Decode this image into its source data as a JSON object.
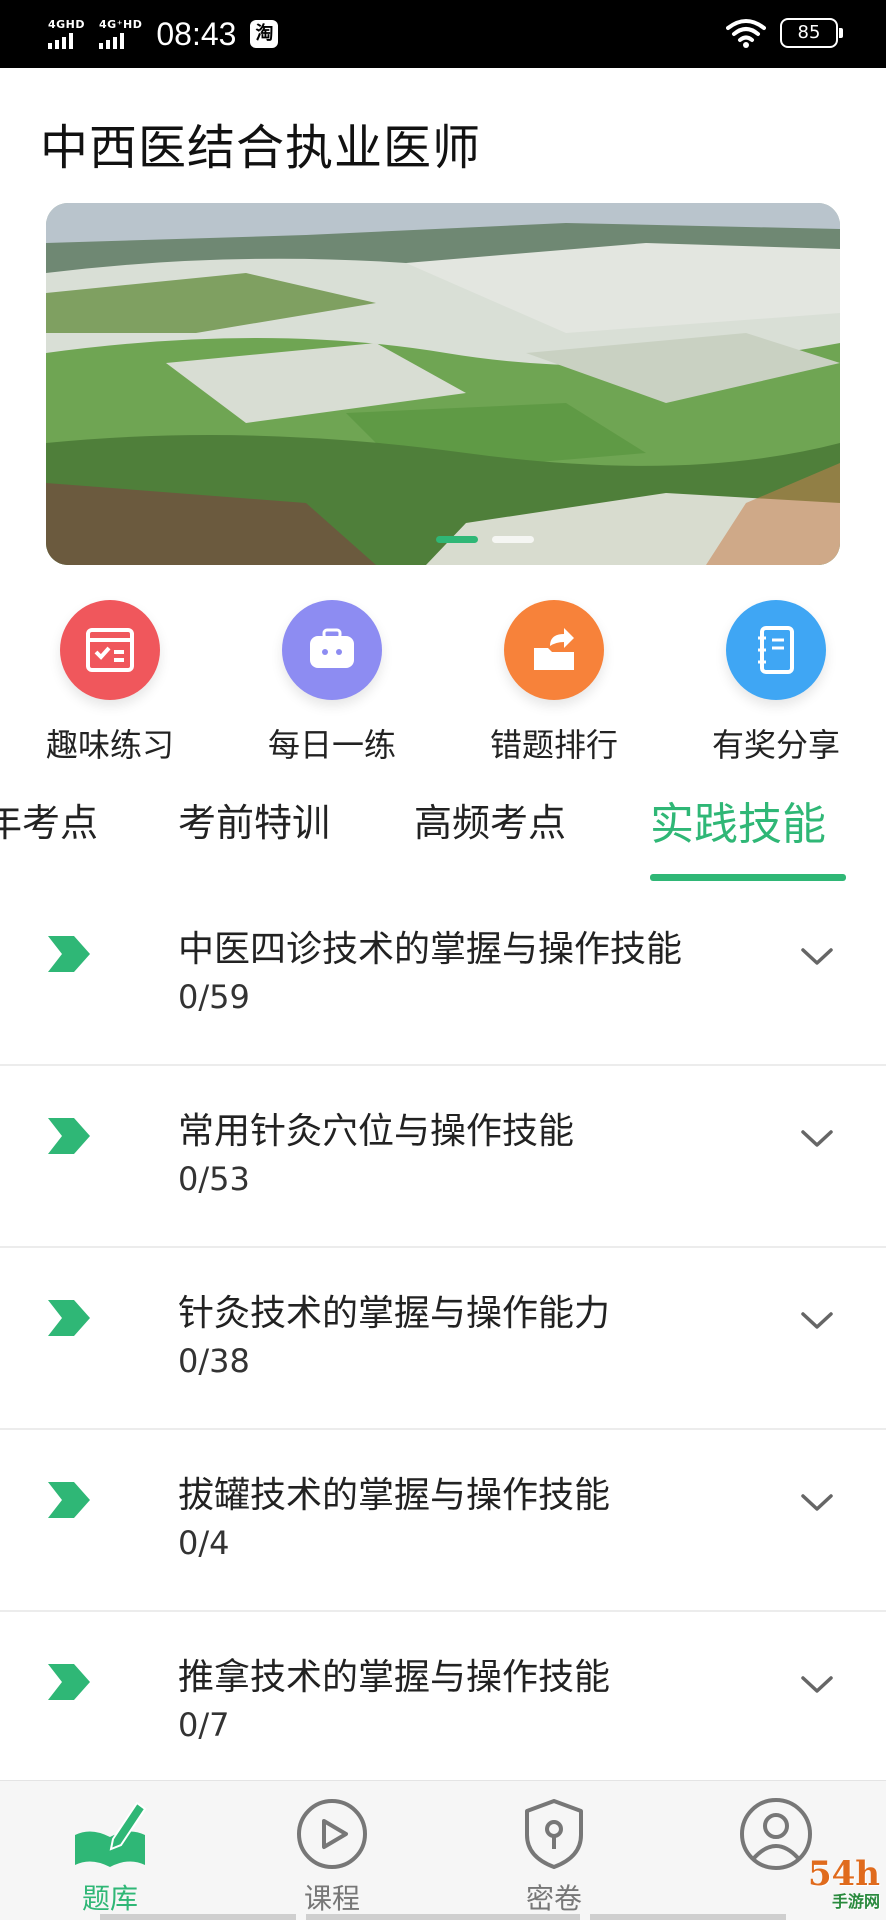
{
  "status_bar": {
    "network1": "4GHD",
    "network2": "4G⁺HD",
    "time": "08:43",
    "app_badge": "淘",
    "battery": "85"
  },
  "header": {
    "title": "中西医结合执业医师"
  },
  "banner": {
    "slides": 2,
    "active_slide": 0,
    "image": "snowy green farmland hills"
  },
  "quick_actions": [
    {
      "label": "趣味练习",
      "icon": "practice-form-icon",
      "color": "#f0575c"
    },
    {
      "label": "每日一练",
      "icon": "briefcase-icon",
      "color": "#8d8cf2"
    },
    {
      "label": "错题排行",
      "icon": "share-folder-icon",
      "color": "#f7823a"
    },
    {
      "label": "有奖分享",
      "icon": "notebook-icon",
      "color": "#3fa6f4"
    }
  ],
  "tabs": [
    {
      "label": "年考点",
      "active": false
    },
    {
      "label": "考前特训",
      "active": false
    },
    {
      "label": "高频考点",
      "active": false
    },
    {
      "label": "实践技能",
      "active": true
    }
  ],
  "chapters": [
    {
      "title": "中医四诊技术的掌握与操作技能",
      "progress": "0/59"
    },
    {
      "title": "常用针灸穴位与操作技能",
      "progress": "0/53"
    },
    {
      "title": "针灸技术的掌握与操作能力",
      "progress": "0/38"
    },
    {
      "title": "拔罐技术的掌握与操作技能",
      "progress": "0/4"
    },
    {
      "title": "推拿技术的掌握与操作技能",
      "progress": "0/7"
    }
  ],
  "bottom_nav": [
    {
      "label": "题库",
      "icon": "question-bank-icon",
      "active": true
    },
    {
      "label": "课程",
      "icon": "play-circle-icon",
      "active": false
    },
    {
      "label": "密卷",
      "icon": "lock-shield-icon",
      "active": false
    },
    {
      "label": "",
      "icon": "profile-icon",
      "active": false
    }
  ],
  "watermark": {
    "main": "54h",
    "sub": "手游网"
  },
  "colors": {
    "accent": "#2fb776",
    "text": "#222222",
    "divider": "#ececec"
  }
}
